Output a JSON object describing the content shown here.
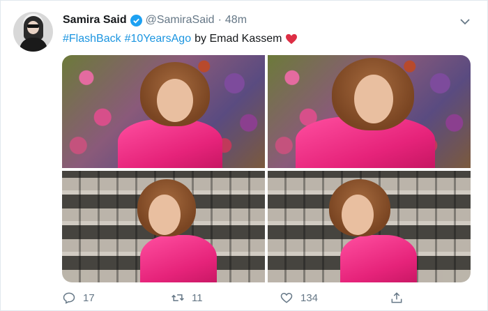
{
  "tweet": {
    "name": "Samira Said",
    "handle": "@SamiraSaid",
    "separator": "·",
    "time": "48m",
    "hashtag1": "#FlashBack",
    "hashtag2": "#10YearsAgo",
    "body_text": "by Emad Kassem",
    "verified": true,
    "colors": {
      "link": "#1b95e0",
      "verified": "#1da1f2",
      "heart": "#e0245e",
      "muted": "#657786"
    }
  },
  "media": {
    "photos": [
      {
        "name": "photo-pink-jacket-flowers-1",
        "icon": "photo"
      },
      {
        "name": "photo-pink-jacket-flowers-2",
        "icon": "photo"
      },
      {
        "name": "photo-pink-jacket-wall-1",
        "icon": "photo"
      },
      {
        "name": "photo-pink-jacket-wall-2",
        "icon": "photo"
      }
    ]
  },
  "actions": {
    "reply_count": "17",
    "retweet_count": "11",
    "like_count": "134",
    "icons": [
      "reply-icon",
      "retweet-icon",
      "like-icon",
      "share-icon"
    ]
  }
}
